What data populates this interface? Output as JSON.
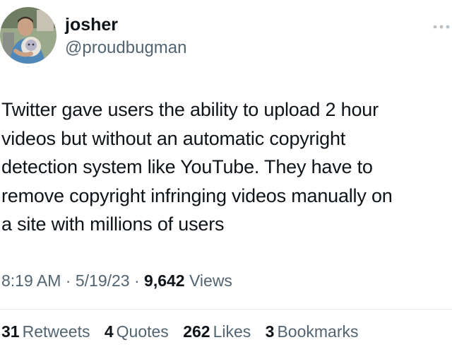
{
  "user": {
    "display_name": "josher",
    "handle": "@proudbugman",
    "avatar_icon": "profile-photo-person-holding-plush"
  },
  "more_icon": "more-horizontal-icon",
  "tweet": {
    "lines": [
      "Twitter gave users the ability to upload 2 hour",
      "videos but without an automatic copyright",
      "detection system like YouTube. They have to",
      "remove copyright infringing videos manually on",
      "a site with millions of users"
    ]
  },
  "meta": {
    "time": "8:19 AM",
    "separator": "·",
    "date": "5/19/23",
    "views_count": "9,642",
    "views_label": "Views"
  },
  "stats": [
    {
      "count": "31",
      "label": "Retweets"
    },
    {
      "count": "4",
      "label": "Quotes"
    },
    {
      "count": "262",
      "label": "Likes"
    },
    {
      "count": "3",
      "label": "Bookmarks"
    }
  ],
  "colors": {
    "text_primary": "#0f1419",
    "text_secondary": "#536471",
    "divider": "#e6ebee"
  }
}
